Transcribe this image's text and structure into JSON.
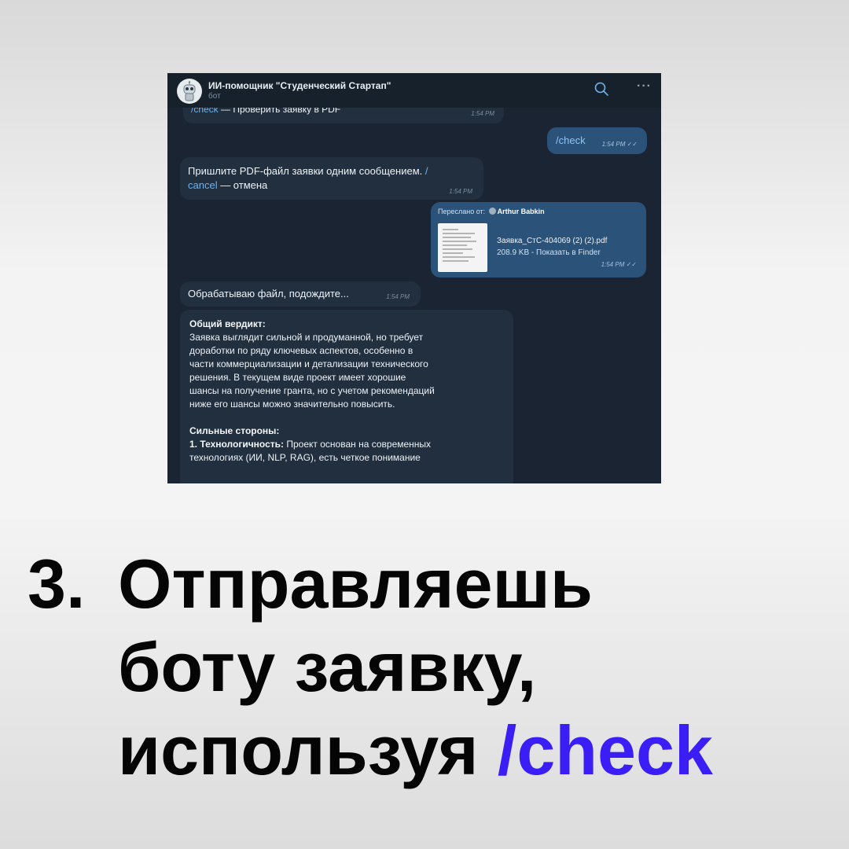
{
  "chat": {
    "title": "ИИ-помощник \"Студенческий Стартап\"",
    "subtitle": "бот",
    "icons": {
      "search": "search-icon",
      "more": "more-icon",
      "avatar": "robot-avatar"
    },
    "messages": [
      {
        "id": "b1",
        "direction": "in",
        "link": "/check",
        "text": " — Проверить заявку в PDF",
        "time": "1:54 PM"
      },
      {
        "id": "b2",
        "direction": "out",
        "text": "/check",
        "time": "1:54 PM",
        "status": "read"
      },
      {
        "id": "b3",
        "direction": "in",
        "text": "Пришлите PDF-файл заявки одним сообщением.",
        "link1": " /",
        "link2": "cancel",
        "text2": " — отмена",
        "time": "1:54 PM"
      },
      {
        "id": "b4",
        "direction": "out",
        "forward_label": "Переслано от:",
        "forward_from": "Arthur Babkin",
        "file_name": "Заявка_СтС-404069 (2) (2).pdf",
        "file_size": "208.9 KB",
        "file_action": "Показать в Finder",
        "time": "1:54 PM",
        "status": "read"
      },
      {
        "id": "b5",
        "direction": "in",
        "text": "Обрабатываю файл, подождите...",
        "time": "1:54 PM"
      },
      {
        "id": "b6",
        "direction": "in",
        "verdict_title": "Общий вердикт:",
        "verdict_lines": [
          "Заявка выглядит сильной и продуманной, но требует",
          "доработки по ряду ключевых аспектов, особенно в",
          "части коммерциализации и детализации технического",
          "решения. В текущем виде проект имеет хорошие",
          "шансы на получение гранта, но с учетом рекомендаций",
          "ниже его шансы можно значительно повысить."
        ],
        "strengths_title": "Сильные стороны:",
        "strength_1_label": "1. Технологичность:",
        "strength_1_text": " Проект основан на современных",
        "strength_1_cont": "технологиях (ИИ, NLP, RAG), есть четкое понимание"
      }
    ]
  },
  "caption": {
    "number": "3.",
    "line1": "Отправляешь",
    "line2": "боту заявку,",
    "line3_text": "используя ",
    "line3_accent": "/check",
    "accent_color": "#3a1ef5"
  }
}
